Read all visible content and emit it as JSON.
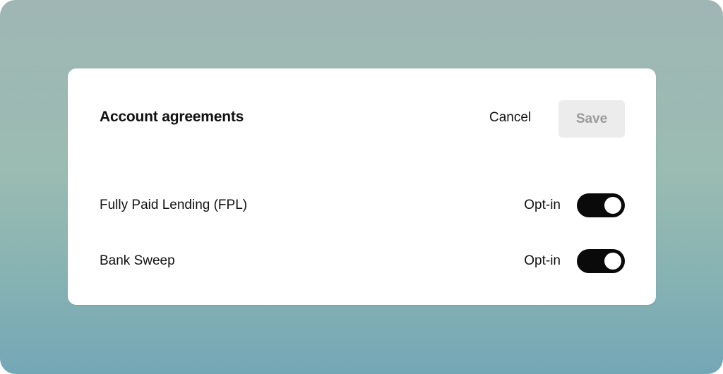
{
  "dialog": {
    "title": "Account agreements",
    "cancel_label": "Cancel",
    "save_label": "Save",
    "save_enabled": false
  },
  "agreements": [
    {
      "label": "Fully Paid Lending (FPL)",
      "state_label": "Opt-in",
      "enabled": true
    },
    {
      "label": "Bank Sweep",
      "state_label": "Opt-in",
      "enabled": true
    }
  ],
  "colors": {
    "toggle_on": "#0a0a0a",
    "save_disabled_bg": "#ececec",
    "save_disabled_text": "#9a9a9a"
  }
}
